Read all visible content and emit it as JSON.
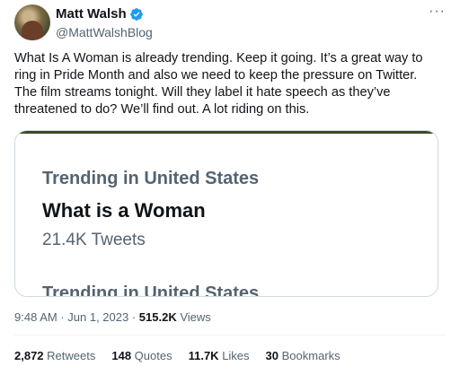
{
  "author": {
    "name": "Matt Walsh",
    "handle": "@MattWalshBlog"
  },
  "icons": {
    "verified": "verified-badge-icon",
    "more": "more-options-icon",
    "verified_color": "#1d9bf0"
  },
  "more_glyph": "···",
  "tweet_text": "What Is A Woman is already trending. Keep it going. It’s a great way to ring in Pride Month and also we need to keep the pressure on Twitter. The film streams tonight. Will they label it hate speech as they’ve threatened to do? We’ll find out. A lot riding on this.",
  "media": {
    "trend_label": "Trending in United States",
    "trend_title": "What is a Woman",
    "trend_count": "21.4K Tweets",
    "trend_label_2": "Trending in United States"
  },
  "meta": {
    "time": "9:48 AM",
    "sep1": " · ",
    "date": "Jun 1, 2023",
    "sep2": " · ",
    "views_count": "515.2K",
    "views_label": " Views"
  },
  "stats": {
    "retweets_count": "2,872",
    "retweets_label": " Retweets",
    "quotes_count": "148",
    "quotes_label": " Quotes",
    "likes_count": "11.7K",
    "likes_label": " Likes",
    "bookmarks_count": "30",
    "bookmarks_label": " Bookmarks"
  }
}
